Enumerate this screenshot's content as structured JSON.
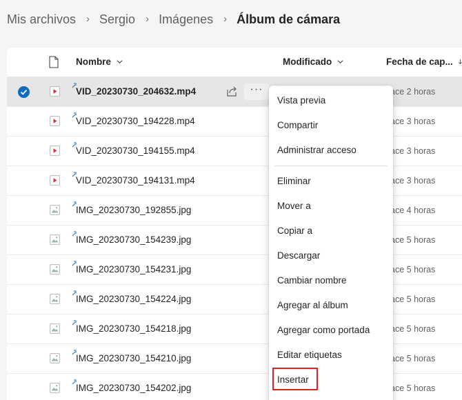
{
  "breadcrumb": {
    "items": [
      "Mis archivos",
      "Sergio",
      "Imágenes"
    ],
    "current": "Álbum de cámara",
    "separator": "›"
  },
  "columns": {
    "name": "Nombre",
    "modified": "Modificado",
    "capture_date": "Fecha de cap..."
  },
  "files": [
    {
      "name": "VID_20230730_204632.mp4",
      "type": "video",
      "date": "Hace 2 horas",
      "selected": true
    },
    {
      "name": "VID_20230730_194228.mp4",
      "type": "video",
      "date": "Hace 3 horas"
    },
    {
      "name": "VID_20230730_194155.mp4",
      "type": "video",
      "date": "Hace 3 horas"
    },
    {
      "name": "VID_20230730_194131.mp4",
      "type": "video",
      "date": "Hace 3 horas"
    },
    {
      "name": "IMG_20230730_192855.jpg",
      "type": "image",
      "date": "Hace 4 horas"
    },
    {
      "name": "IMG_20230730_154239.jpg",
      "type": "image",
      "date": "Hace 5 horas"
    },
    {
      "name": "IMG_20230730_154231.jpg",
      "type": "image",
      "date": "Hace 5 horas"
    },
    {
      "name": "IMG_20230730_154224.jpg",
      "type": "image",
      "date": "Hace 5 horas"
    },
    {
      "name": "IMG_20230730_154218.jpg",
      "type": "image",
      "date": "Hace 5 horas"
    },
    {
      "name": "IMG_20230730_154210.jpg",
      "type": "image",
      "date": "Hace 5 horas"
    },
    {
      "name": "IMG_20230730_154202.jpg",
      "type": "image",
      "date": "Hace 5 horas"
    }
  ],
  "row_actions": {
    "share_icon": "share-icon",
    "more_label": "···"
  },
  "context_menu": {
    "items": [
      "Vista previa",
      "Compartir",
      "Administrar acceso",
      "Eliminar",
      "Mover a",
      "Copiar a",
      "Descargar",
      "Cambiar nombre",
      "Agregar al álbum",
      "Agregar como portada",
      "Editar etiquetas",
      "Insertar"
    ],
    "highlighted_item": "Insertar"
  },
  "colors": {
    "accent": "#0f6cbd",
    "video_icon": "#d13438",
    "image_icon": "#9ab7a0",
    "highlight_border": "#e0201a"
  }
}
